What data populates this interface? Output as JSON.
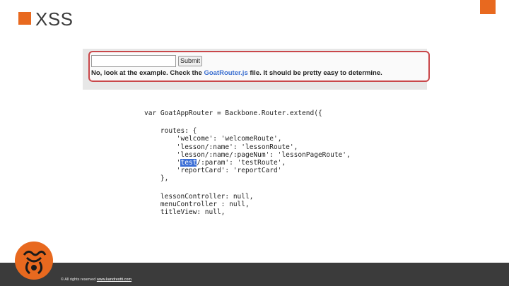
{
  "slide": {
    "title": "XSS"
  },
  "screenshot": {
    "submit_label": "Submit",
    "message_before": "No, look at the example. Check the ",
    "message_link": "GoatRouter.js",
    "message_after": " file. It should be pretty easy to determine."
  },
  "code": {
    "lines": [
      "var GoatAppRouter = Backbone.Router.extend({",
      "",
      "    routes: {",
      "        'welcome': 'welcomeRoute',",
      "        'lesson/:name': 'lessonRoute',",
      "        'lesson/:name/:pageNum': 'lessonPageRoute',",
      "        'test/:param': 'testRoute',",
      "        'reportCard': 'reportCard'",
      "    },",
      "",
      "    lessonController: null,",
      "    menuController : null,",
      "    titleView: null,"
    ],
    "highlight_word": "test"
  },
  "footer": {
    "text": "© All rights reserved ",
    "link": "www.kandreotti.com"
  },
  "colors": {
    "accent": "#e8691f",
    "footer": "#3b3b3b",
    "frame": "#c9474a",
    "link": "#3b6fd0"
  }
}
